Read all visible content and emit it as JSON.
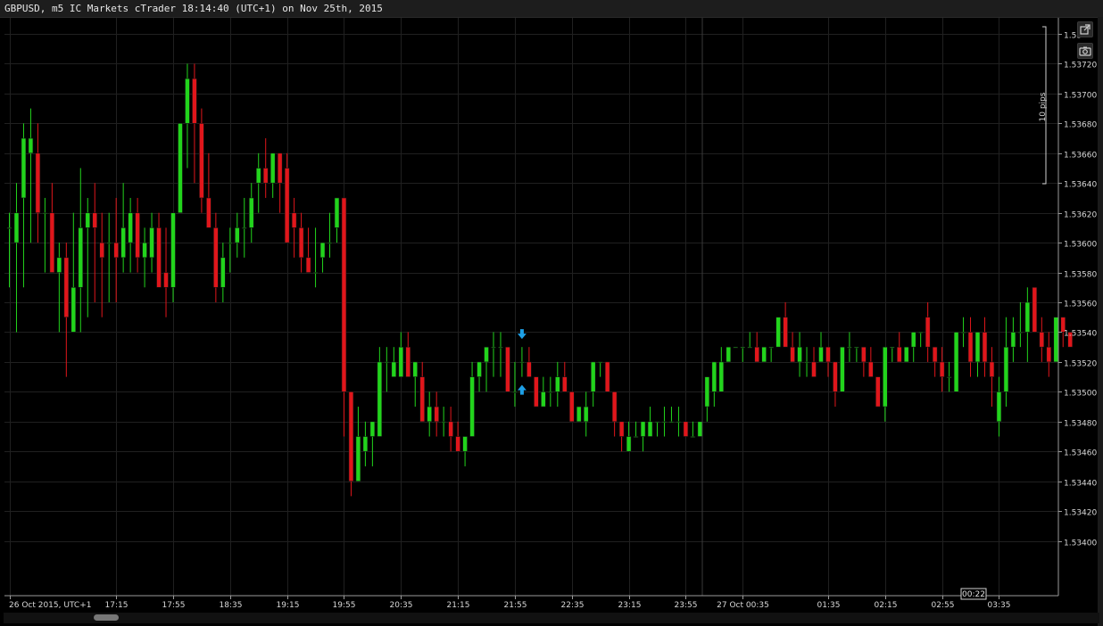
{
  "window": {
    "title": "GBPUSD, m5 IC Markets cTrader 18:14:40 (UTC+1) on Nov 25th, 2015"
  },
  "toolbar": {
    "popout_icon": "popout-icon",
    "camera_icon": "camera-icon"
  },
  "ruler": {
    "label": "10 pips"
  },
  "countdown": "00:22",
  "colors": {
    "bull": "#22d41c",
    "bear": "#e0161b",
    "arrow": "#1ea0e6",
    "grid": "#202020",
    "background": "#000000"
  },
  "chart_data": {
    "type": "candlestick",
    "symbol": "GBPUSD",
    "timeframe": "m5",
    "ylim": [
      1.5338,
      1.5374
    ],
    "y_ticks": [
      "1.53",
      "1.53720",
      "1.53700",
      "1.53680",
      "1.53660",
      "1.53640",
      "1.53620",
      "1.53600",
      "1.53580",
      "1.53560",
      "1.53540",
      "1.53520",
      "1.53500",
      "1.53480",
      "1.53460",
      "1.53440",
      "1.53420",
      "1.53400"
    ],
    "y_tick_values": [
      1.5374,
      1.5372,
      1.537,
      1.5368,
      1.5366,
      1.5364,
      1.5362,
      1.536,
      1.5358,
      1.5356,
      1.5354,
      1.5352,
      1.535,
      1.5348,
      1.5346,
      1.5344,
      1.5342,
      1.534
    ],
    "x_labels": [
      "26 Oct 2015, UTC+1",
      "17:15",
      "17:55",
      "18:35",
      "19:15",
      "19:55",
      "20:35",
      "21:15",
      "21:55",
      "22:35",
      "23:15",
      "23:55",
      "27 Oct 00:35",
      "01:35",
      "02:15",
      "02:55",
      "03:35"
    ],
    "x_label_index": [
      0,
      15,
      23,
      31,
      39,
      47,
      55,
      63,
      71,
      79,
      87,
      95,
      103,
      115,
      123,
      131,
      139
    ],
    "candles": [
      {
        "o": 1.5361,
        "h": 1.5362,
        "l": 1.5357,
        "c": 1.5361
      },
      {
        "o": 1.536,
        "h": 1.5364,
        "l": 1.5354,
        "c": 1.5362
      },
      {
        "o": 1.5363,
        "h": 1.5368,
        "l": 1.5357,
        "c": 1.5367
      },
      {
        "o": 1.5366,
        "h": 1.5369,
        "l": 1.536,
        "c": 1.5367
      },
      {
        "o": 1.5366,
        "h": 1.5368,
        "l": 1.536,
        "c": 1.5362
      },
      {
        "o": 1.5362,
        "h": 1.5363,
        "l": 1.5358,
        "c": 1.5362
      },
      {
        "o": 1.5362,
        "h": 1.5364,
        "l": 1.536,
        "c": 1.5358
      },
      {
        "o": 1.5358,
        "h": 1.536,
        "l": 1.5354,
        "c": 1.5359
      },
      {
        "o": 1.5359,
        "h": 1.536,
        "l": 1.5351,
        "c": 1.5355
      },
      {
        "o": 1.5354,
        "h": 1.5362,
        "l": 1.5354,
        "c": 1.5357
      },
      {
        "o": 1.5357,
        "h": 1.5365,
        "l": 1.5354,
        "c": 1.5361
      },
      {
        "o": 1.5361,
        "h": 1.5363,
        "l": 1.5355,
        "c": 1.5362
      },
      {
        "o": 1.5362,
        "h": 1.5364,
        "l": 1.5356,
        "c": 1.5361
      },
      {
        "o": 1.536,
        "h": 1.5362,
        "l": 1.5355,
        "c": 1.5359
      },
      {
        "o": 1.536,
        "h": 1.5362,
        "l": 1.5356,
        "c": 1.536
      },
      {
        "o": 1.536,
        "h": 1.5363,
        "l": 1.5356,
        "c": 1.5359
      },
      {
        "o": 1.5359,
        "h": 1.5364,
        "l": 1.5358,
        "c": 1.5361
      },
      {
        "o": 1.536,
        "h": 1.5363,
        "l": 1.5358,
        "c": 1.5362
      },
      {
        "o": 1.5362,
        "h": 1.5363,
        "l": 1.5358,
        "c": 1.5359
      },
      {
        "o": 1.5359,
        "h": 1.5361,
        "l": 1.5357,
        "c": 1.536
      },
      {
        "o": 1.5359,
        "h": 1.5362,
        "l": 1.5358,
        "c": 1.5361
      },
      {
        "o": 1.5361,
        "h": 1.5362,
        "l": 1.5357,
        "c": 1.5357
      },
      {
        "o": 1.5358,
        "h": 1.5361,
        "l": 1.5355,
        "c": 1.5357
      },
      {
        "o": 1.5357,
        "h": 1.5362,
        "l": 1.5356,
        "c": 1.5362
      },
      {
        "o": 1.5362,
        "h": 1.5368,
        "l": 1.5362,
        "c": 1.5368
      },
      {
        "o": 1.5368,
        "h": 1.5372,
        "l": 1.5365,
        "c": 1.5371
      },
      {
        "o": 1.5371,
        "h": 1.5372,
        "l": 1.5364,
        "c": 1.5368
      },
      {
        "o": 1.5368,
        "h": 1.5369,
        "l": 1.5362,
        "c": 1.5363
      },
      {
        "o": 1.5363,
        "h": 1.5366,
        "l": 1.5361,
        "c": 1.5361
      },
      {
        "o": 1.5361,
        "h": 1.5362,
        "l": 1.5356,
        "c": 1.5357
      },
      {
        "o": 1.5357,
        "h": 1.536,
        "l": 1.5356,
        "c": 1.5359
      },
      {
        "o": 1.536,
        "h": 1.5361,
        "l": 1.5358,
        "c": 1.536
      },
      {
        "o": 1.536,
        "h": 1.5362,
        "l": 1.5359,
        "c": 1.5361
      },
      {
        "o": 1.5361,
        "h": 1.5363,
        "l": 1.5359,
        "c": 1.5361
      },
      {
        "o": 1.5361,
        "h": 1.5364,
        "l": 1.536,
        "c": 1.5363
      },
      {
        "o": 1.5364,
        "h": 1.5366,
        "l": 1.5362,
        "c": 1.5365
      },
      {
        "o": 1.5365,
        "h": 1.5367,
        "l": 1.5363,
        "c": 1.5364
      },
      {
        "o": 1.5364,
        "h": 1.5366,
        "l": 1.5363,
        "c": 1.5366
      },
      {
        "o": 1.5366,
        "h": 1.5366,
        "l": 1.5362,
        "c": 1.5364
      },
      {
        "o": 1.5365,
        "h": 1.5366,
        "l": 1.536,
        "c": 1.536
      },
      {
        "o": 1.5362,
        "h": 1.5363,
        "l": 1.5359,
        "c": 1.5361
      },
      {
        "o": 1.5361,
        "h": 1.5362,
        "l": 1.5358,
        "c": 1.5359
      },
      {
        "o": 1.5359,
        "h": 1.5361,
        "l": 1.5358,
        "c": 1.5358
      },
      {
        "o": 1.5358,
        "h": 1.5361,
        "l": 1.5357,
        "c": 1.5358
      },
      {
        "o": 1.5359,
        "h": 1.536,
        "l": 1.5358,
        "c": 1.536
      },
      {
        "o": 1.536,
        "h": 1.5362,
        "l": 1.5359,
        "c": 1.536
      },
      {
        "o": 1.5361,
        "h": 1.5363,
        "l": 1.536,
        "c": 1.5363
      },
      {
        "o": 1.5363,
        "h": 1.5363,
        "l": 1.5347,
        "c": 1.535
      },
      {
        "o": 1.535,
        "h": 1.535,
        "l": 1.5343,
        "c": 1.5344
      },
      {
        "o": 1.5344,
        "h": 1.5349,
        "l": 1.5344,
        "c": 1.5347
      },
      {
        "o": 1.5346,
        "h": 1.5348,
        "l": 1.5345,
        "c": 1.5347
      },
      {
        "o": 1.5347,
        "h": 1.5348,
        "l": 1.5345,
        "c": 1.5348
      },
      {
        "o": 1.5347,
        "h": 1.5353,
        "l": 1.5347,
        "c": 1.5352
      },
      {
        "o": 1.5352,
        "h": 1.5353,
        "l": 1.535,
        "c": 1.5352
      },
      {
        "o": 1.5351,
        "h": 1.5353,
        "l": 1.5351,
        "c": 1.5352
      },
      {
        "o": 1.5351,
        "h": 1.5354,
        "l": 1.5351,
        "c": 1.5353
      },
      {
        "o": 1.5353,
        "h": 1.5354,
        "l": 1.5351,
        "c": 1.5351
      },
      {
        "o": 1.5351,
        "h": 1.5352,
        "l": 1.5349,
        "c": 1.5352
      },
      {
        "o": 1.5351,
        "h": 1.5352,
        "l": 1.5348,
        "c": 1.5348
      },
      {
        "o": 1.5348,
        "h": 1.535,
        "l": 1.5347,
        "c": 1.5349
      },
      {
        "o": 1.5349,
        "h": 1.535,
        "l": 1.5347,
        "c": 1.5348
      },
      {
        "o": 1.5348,
        "h": 1.5349,
        "l": 1.5347,
        "c": 1.5348
      },
      {
        "o": 1.5348,
        "h": 1.5349,
        "l": 1.5346,
        "c": 1.5347
      },
      {
        "o": 1.5347,
        "h": 1.5348,
        "l": 1.5346,
        "c": 1.5346
      },
      {
        "o": 1.5346,
        "h": 1.5347,
        "l": 1.5345,
        "c": 1.5347
      },
      {
        "o": 1.5347,
        "h": 1.5352,
        "l": 1.5347,
        "c": 1.5351
      },
      {
        "o": 1.5351,
        "h": 1.5352,
        "l": 1.535,
        "c": 1.5352
      },
      {
        "o": 1.5352,
        "h": 1.5353,
        "l": 1.535,
        "c": 1.5353
      },
      {
        "o": 1.5353,
        "h": 1.5354,
        "l": 1.5351,
        "c": 1.5353
      },
      {
        "o": 1.5353,
        "h": 1.5354,
        "l": 1.5351,
        "c": 1.5353
      },
      {
        "o": 1.5353,
        "h": 1.5353,
        "l": 1.535,
        "c": 1.535
      },
      {
        "o": 1.535,
        "h": 1.5352,
        "l": 1.5349,
        "c": 1.535
      },
      {
        "o": 1.5352,
        "h": 1.5353,
        "l": 1.5351,
        "c": 1.5352
      },
      {
        "o": 1.5352,
        "h": 1.5353,
        "l": 1.5351,
        "c": 1.5351
      },
      {
        "o": 1.5351,
        "h": 1.5351,
        "l": 1.5349,
        "c": 1.5349
      },
      {
        "o": 1.5349,
        "h": 1.5351,
        "l": 1.5349,
        "c": 1.535
      },
      {
        "o": 1.535,
        "h": 1.5351,
        "l": 1.5349,
        "c": 1.535
      },
      {
        "o": 1.535,
        "h": 1.5352,
        "l": 1.5349,
        "c": 1.5351
      },
      {
        "o": 1.5351,
        "h": 1.5352,
        "l": 1.535,
        "c": 1.535
      },
      {
        "o": 1.535,
        "h": 1.535,
        "l": 1.5348,
        "c": 1.5348
      },
      {
        "o": 1.5348,
        "h": 1.5349,
        "l": 1.5348,
        "c": 1.5349
      },
      {
        "o": 1.5348,
        "h": 1.535,
        "l": 1.5347,
        "c": 1.5349
      },
      {
        "o": 1.535,
        "h": 1.5352,
        "l": 1.5349,
        "c": 1.5352
      },
      {
        "o": 1.5352,
        "h": 1.5352,
        "l": 1.5351,
        "c": 1.5352
      },
      {
        "o": 1.5352,
        "h": 1.5352,
        "l": 1.535,
        "c": 1.535
      },
      {
        "o": 1.535,
        "h": 1.535,
        "l": 1.5347,
        "c": 1.5348
      },
      {
        "o": 1.5348,
        "h": 1.5348,
        "l": 1.5346,
        "c": 1.5347
      },
      {
        "o": 1.5346,
        "h": 1.5348,
        "l": 1.5346,
        "c": 1.5347
      },
      {
        "o": 1.5347,
        "h": 1.5348,
        "l": 1.5347,
        "c": 1.5347
      },
      {
        "o": 1.5347,
        "h": 1.5348,
        "l": 1.5346,
        "c": 1.5348
      },
      {
        "o": 1.5347,
        "h": 1.5349,
        "l": 1.5347,
        "c": 1.5348
      },
      {
        "o": 1.5348,
        "h": 1.5348,
        "l": 1.5347,
        "c": 1.5348
      },
      {
        "o": 1.5348,
        "h": 1.5349,
        "l": 1.5347,
        "c": 1.5348
      },
      {
        "o": 1.5348,
        "h": 1.5349,
        "l": 1.5348,
        "c": 1.5348
      },
      {
        "o": 1.5348,
        "h": 1.5349,
        "l": 1.5347,
        "c": 1.5348
      },
      {
        "o": 1.5348,
        "h": 1.5348,
        "l": 1.5347,
        "c": 1.5347
      },
      {
        "o": 1.5347,
        "h": 1.5348,
        "l": 1.5347,
        "c": 1.5347
      },
      {
        "o": 1.5347,
        "h": 1.5348,
        "l": 1.5347,
        "c": 1.5348
      },
      {
        "o": 1.5349,
        "h": 1.5351,
        "l": 1.5348,
        "c": 1.5351
      },
      {
        "o": 1.535,
        "h": 1.5352,
        "l": 1.5349,
        "c": 1.5352
      },
      {
        "o": 1.535,
        "h": 1.5353,
        "l": 1.535,
        "c": 1.5352
      },
      {
        "o": 1.5352,
        "h": 1.5353,
        "l": 1.5352,
        "c": 1.5353
      },
      {
        "o": 1.5353,
        "h": 1.5353,
        "l": 1.5353,
        "c": 1.5353
      },
      {
        "o": 1.5353,
        "h": 1.5353,
        "l": 1.5352,
        "c": 1.5353
      },
      {
        "o": 1.5353,
        "h": 1.5354,
        "l": 1.5353,
        "c": 1.5353
      },
      {
        "o": 1.5353,
        "h": 1.5354,
        "l": 1.5352,
        "c": 1.5352
      },
      {
        "o": 1.5352,
        "h": 1.5353,
        "l": 1.5352,
        "c": 1.5353
      },
      {
        "o": 1.5353,
        "h": 1.5353,
        "l": 1.5352,
        "c": 1.5353
      },
      {
        "o": 1.5353,
        "h": 1.5355,
        "l": 1.5353,
        "c": 1.5355
      },
      {
        "o": 1.5355,
        "h": 1.5356,
        "l": 1.5353,
        "c": 1.5353
      },
      {
        "o": 1.5353,
        "h": 1.5354,
        "l": 1.5352,
        "c": 1.5352
      },
      {
        "o": 1.5352,
        "h": 1.5354,
        "l": 1.5351,
        "c": 1.5353
      },
      {
        "o": 1.5352,
        "h": 1.5353,
        "l": 1.5351,
        "c": 1.5352
      },
      {
        "o": 1.5352,
        "h": 1.5353,
        "l": 1.5351,
        "c": 1.5351
      },
      {
        "o": 1.5352,
        "h": 1.5354,
        "l": 1.5352,
        "c": 1.5353
      },
      {
        "o": 1.5353,
        "h": 1.5353,
        "l": 1.5351,
        "c": 1.5352
      },
      {
        "o": 1.5352,
        "h": 1.5352,
        "l": 1.5349,
        "c": 1.535
      },
      {
        "o": 1.535,
        "h": 1.5353,
        "l": 1.535,
        "c": 1.5353
      },
      {
        "o": 1.5353,
        "h": 1.5354,
        "l": 1.5352,
        "c": 1.5353
      },
      {
        "o": 1.5353,
        "h": 1.5353,
        "l": 1.5352,
        "c": 1.5353
      },
      {
        "o": 1.5353,
        "h": 1.5353,
        "l": 1.5351,
        "c": 1.5352
      },
      {
        "o": 1.5352,
        "h": 1.5353,
        "l": 1.5351,
        "c": 1.5351
      },
      {
        "o": 1.5351,
        "h": 1.5351,
        "l": 1.5349,
        "c": 1.5349
      },
      {
        "o": 1.5349,
        "h": 1.5353,
        "l": 1.5348,
        "c": 1.5353
      },
      {
        "o": 1.5353,
        "h": 1.5353,
        "l": 1.5352,
        "c": 1.5353
      },
      {
        "o": 1.5353,
        "h": 1.5354,
        "l": 1.5352,
        "c": 1.5352
      },
      {
        "o": 1.5352,
        "h": 1.5353,
        "l": 1.5352,
        "c": 1.5353
      },
      {
        "o": 1.5353,
        "h": 1.5354,
        "l": 1.5352,
        "c": 1.5354
      },
      {
        "o": 1.5354,
        "h": 1.5354,
        "l": 1.5353,
        "c": 1.5354
      },
      {
        "o": 1.5355,
        "h": 1.5356,
        "l": 1.5352,
        "c": 1.5353
      },
      {
        "o": 1.5353,
        "h": 1.5353,
        "l": 1.5351,
        "c": 1.5352
      },
      {
        "o": 1.5352,
        "h": 1.5353,
        "l": 1.535,
        "c": 1.5351
      },
      {
        "o": 1.5351,
        "h": 1.5352,
        "l": 1.535,
        "c": 1.5351
      },
      {
        "o": 1.535,
        "h": 1.5354,
        "l": 1.535,
        "c": 1.5354
      },
      {
        "o": 1.5354,
        "h": 1.5355,
        "l": 1.5353,
        "c": 1.5354
      },
      {
        "o": 1.5354,
        "h": 1.5355,
        "l": 1.5351,
        "c": 1.5352
      },
      {
        "o": 1.5352,
        "h": 1.5354,
        "l": 1.5351,
        "c": 1.5354
      },
      {
        "o": 1.5354,
        "h": 1.5355,
        "l": 1.5351,
        "c": 1.5352
      },
      {
        "o": 1.5352,
        "h": 1.5353,
        "l": 1.5349,
        "c": 1.5351
      },
      {
        "o": 1.5348,
        "h": 1.5351,
        "l": 1.5347,
        "c": 1.535
      },
      {
        "o": 1.535,
        "h": 1.5355,
        "l": 1.5349,
        "c": 1.5353
      },
      {
        "o": 1.5353,
        "h": 1.5355,
        "l": 1.5352,
        "c": 1.5354
      },
      {
        "o": 1.5354,
        "h": 1.5356,
        "l": 1.5353,
        "c": 1.5354
      },
      {
        "o": 1.5354,
        "h": 1.5357,
        "l": 1.5352,
        "c": 1.5356
      },
      {
        "o": 1.5357,
        "h": 1.5357,
        "l": 1.5354,
        "c": 1.5354
      },
      {
        "o": 1.5354,
        "h": 1.5355,
        "l": 1.5352,
        "c": 1.5353
      },
      {
        "o": 1.5353,
        "h": 1.5354,
        "l": 1.5351,
        "c": 1.5352
      },
      {
        "o": 1.5352,
        "h": 1.5355,
        "l": 1.5352,
        "c": 1.5355
      },
      {
        "o": 1.5355,
        "h": 1.5355,
        "l": 1.5353,
        "c": 1.5354
      },
      {
        "o": 1.5354,
        "h": 1.5354,
        "l": 1.5353,
        "c": 1.5353
      }
    ],
    "arrows": [
      {
        "index": 72,
        "direction": "down"
      },
      {
        "index": 72,
        "direction": "up"
      }
    ]
  }
}
